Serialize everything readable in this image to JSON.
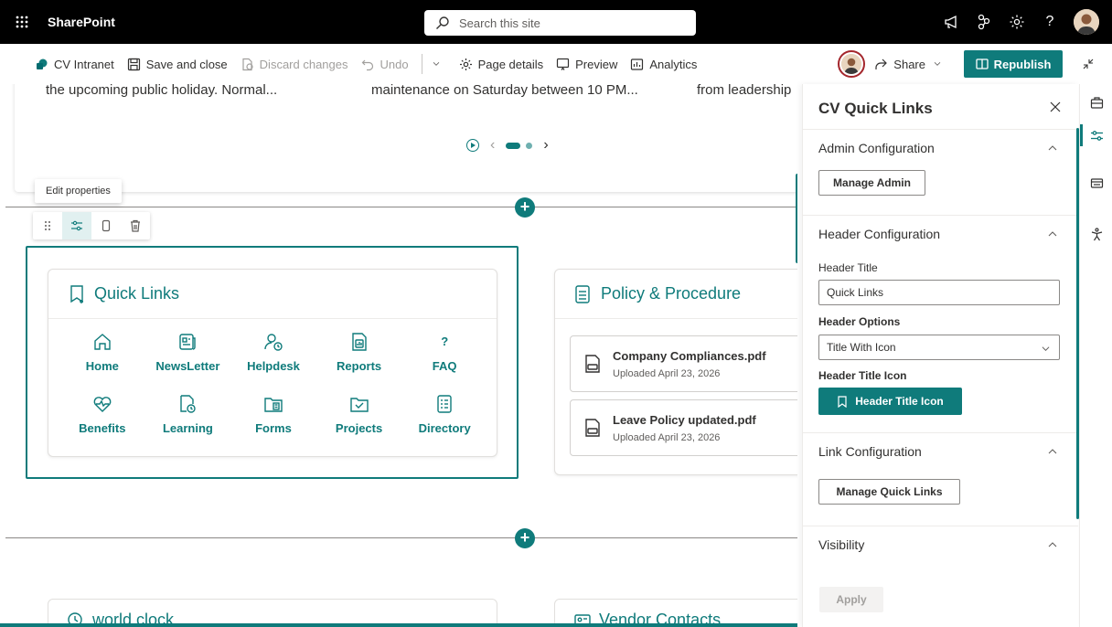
{
  "suitebar": {
    "app_name": "SharePoint",
    "search_placeholder": "Search this site",
    "help_label": "?"
  },
  "commandbar": {
    "site_name": "CV Intranet",
    "save_close": "Save and close",
    "discard": "Discard changes",
    "undo": "Undo",
    "page_details": "Page details",
    "preview": "Preview",
    "analytics": "Analytics",
    "share": "Share",
    "republish": "Republish"
  },
  "news": {
    "item1": "the upcoming public holiday. Normal...",
    "item2": "maintenance on Saturday between 10 PM...",
    "item3": "from leadership"
  },
  "toolbar": {
    "tooltip": "Edit properties"
  },
  "quick_links": {
    "title": "Quick Links",
    "items": [
      {
        "label": "Home",
        "icon": "home-icon"
      },
      {
        "label": "NewsLetter",
        "icon": "newsletter-icon"
      },
      {
        "label": "Helpdesk",
        "icon": "helpdesk-icon"
      },
      {
        "label": "Reports",
        "icon": "reports-icon"
      },
      {
        "label": "FAQ",
        "icon": "faq-icon",
        "glyph": "?"
      },
      {
        "label": "Benefits",
        "icon": "heart-pulse-icon"
      },
      {
        "label": "Learning",
        "icon": "learning-icon"
      },
      {
        "label": "Forms",
        "icon": "forms-icon"
      },
      {
        "label": "Projects",
        "icon": "projects-icon"
      },
      {
        "label": "Directory",
        "icon": "directory-icon"
      }
    ]
  },
  "policy": {
    "title": "Policy & Procedure",
    "docs": [
      {
        "name": "Company Compliances.pdf",
        "date": "Uploaded April 23, 2026"
      },
      {
        "name": "Leave Policy updated.pdf",
        "date": "Uploaded April 23, 2026"
      }
    ]
  },
  "bottom": {
    "world_clock": "world clock",
    "vendor": "Vendor Contacts"
  },
  "pane": {
    "title": "CV Quick Links",
    "admin_section": "Admin Configuration",
    "manage_admin": "Manage Admin",
    "header_section": "Header Configuration",
    "header_title_label": "Header Title",
    "header_title_value": "Quick Links",
    "header_options_label": "Header Options",
    "header_options_value": "Title With Icon",
    "header_icon_label": "Header Title Icon",
    "header_icon_button": "Header Title Icon",
    "link_section": "Link Configuration",
    "manage_links": "Manage Quick Links",
    "visibility_section": "Visibility",
    "apply": "Apply"
  },
  "colors": {
    "accent": "#0f7b7b",
    "suitebar": "#000000"
  }
}
